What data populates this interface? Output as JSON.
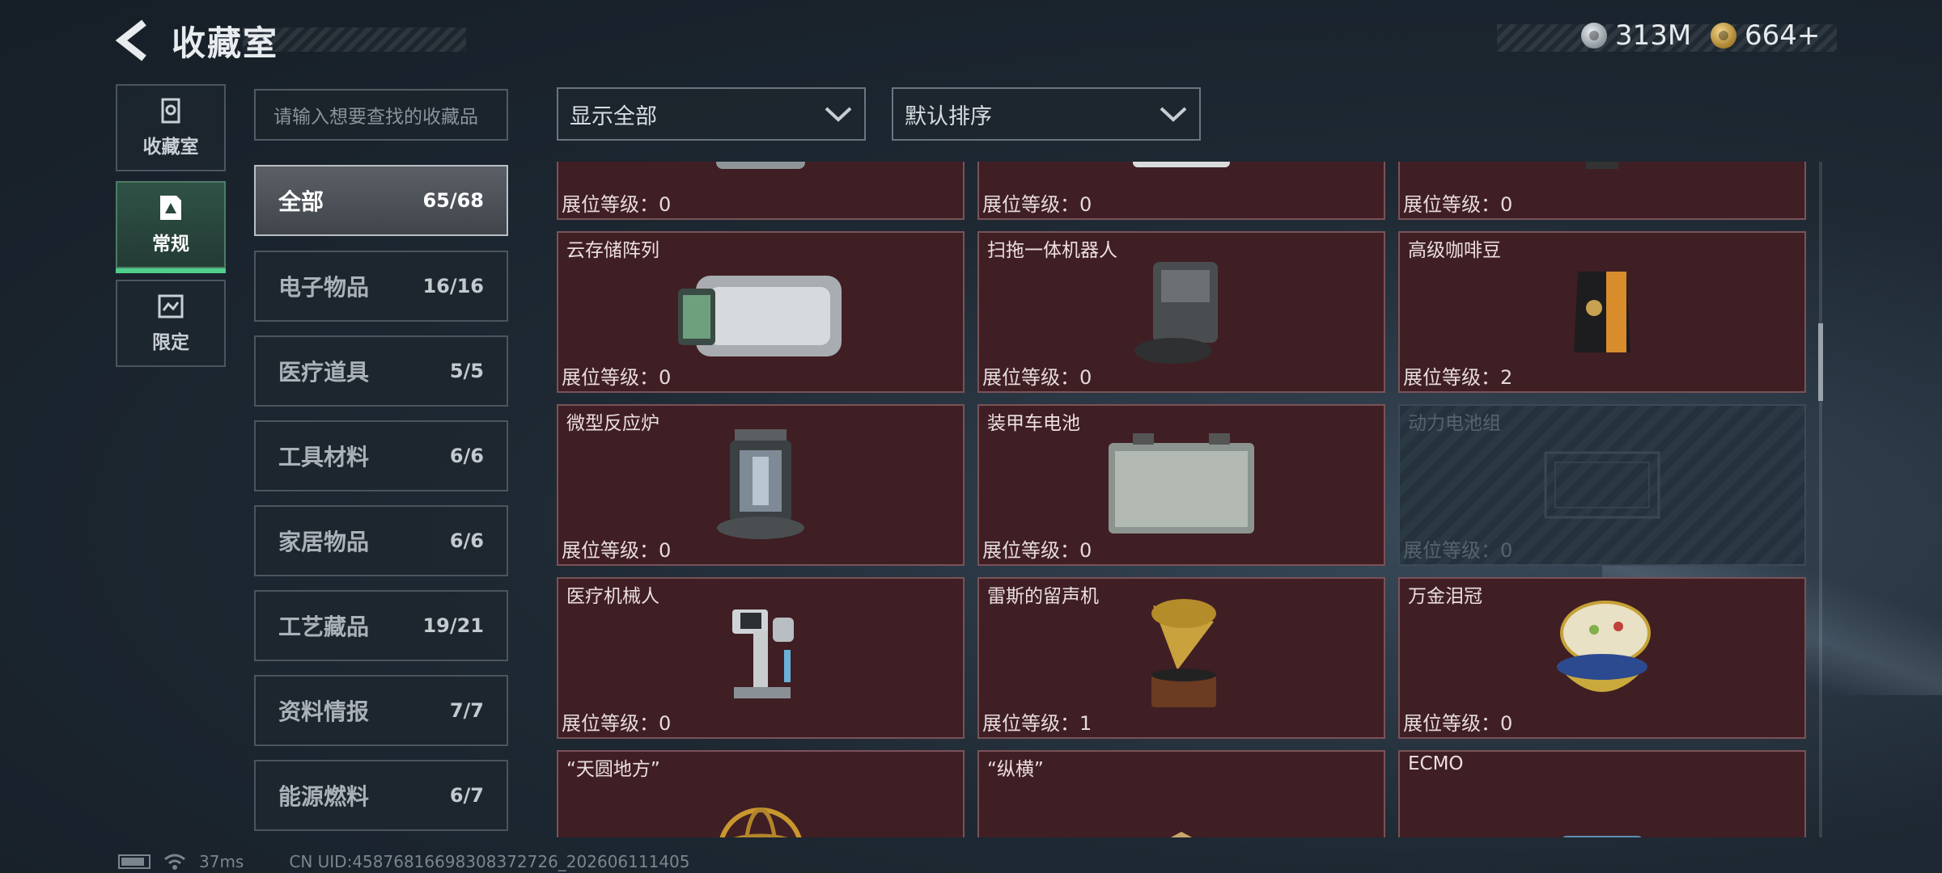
{
  "header": {
    "title": "收藏室",
    "currencies": [
      {
        "icon": "silver-coin-icon",
        "value": "313M"
      },
      {
        "icon": "gold-coin-icon",
        "value": "664+"
      }
    ]
  },
  "side_tabs": [
    {
      "label": "收藏室",
      "icon": "collection-room-icon",
      "active": false
    },
    {
      "label": "常规",
      "icon": "regular-icon",
      "active": true
    },
    {
      "label": "限定",
      "icon": "limited-icon",
      "active": false
    }
  ],
  "search": {
    "placeholder": "请输入想要查找的收藏品"
  },
  "filters": {
    "display": "显示全部",
    "sort": "默认排序"
  },
  "categories": [
    {
      "name": "全部",
      "count": "65/68",
      "active": true
    },
    {
      "name": "电子物品",
      "count": "16/16"
    },
    {
      "name": "医疗道具",
      "count": "5/5"
    },
    {
      "name": "工具材料",
      "count": "6/6"
    },
    {
      "name": "家居物品",
      "count": "6/6"
    },
    {
      "name": "工艺藏品",
      "count": "19/21"
    },
    {
      "name": "资料情报",
      "count": "7/7"
    },
    {
      "name": "能源燃料",
      "count": "6/7"
    }
  ],
  "level_label": "展位等级：",
  "items": [
    {
      "name": "",
      "level": "0",
      "icon": "metal-case-icon"
    },
    {
      "name": "",
      "level": "0",
      "icon": "appliance-icon"
    },
    {
      "name": "",
      "level": "0",
      "icon": "figurine-icon"
    },
    {
      "name": "云存储阵列",
      "level": "0",
      "icon": "storage-array-icon"
    },
    {
      "name": "扫拖一体机器人",
      "level": "0",
      "icon": "robot-vacuum-icon"
    },
    {
      "name": "高级咖啡豆",
      "level": "2",
      "icon": "coffee-bag-icon"
    },
    {
      "name": "微型反应炉",
      "level": "0",
      "icon": "reactor-icon"
    },
    {
      "name": "装甲车电池",
      "level": "0",
      "icon": "battery-icon"
    },
    {
      "name": "动力电池组",
      "level": "0",
      "icon": "battery-pack-icon",
      "locked": true
    },
    {
      "name": "医疗机械人",
      "level": "0",
      "icon": "medical-robot-icon"
    },
    {
      "name": "雷斯的留声机",
      "level": "1",
      "icon": "gramophone-icon"
    },
    {
      "name": "万金泪冠",
      "level": "0",
      "icon": "jeweled-egg-icon"
    },
    {
      "name": "“天圆地方”",
      "level": "",
      "icon": "armillary-sphere-icon"
    },
    {
      "name": "“纵横”",
      "level": "",
      "icon": "chessboard-icon"
    },
    {
      "name": "ECMO",
      "level": "",
      "icon": "ecmo-machine-icon"
    }
  ],
  "status": {
    "ping": "37ms",
    "uid": "CN UID:45876816698308372726_202606111405"
  }
}
